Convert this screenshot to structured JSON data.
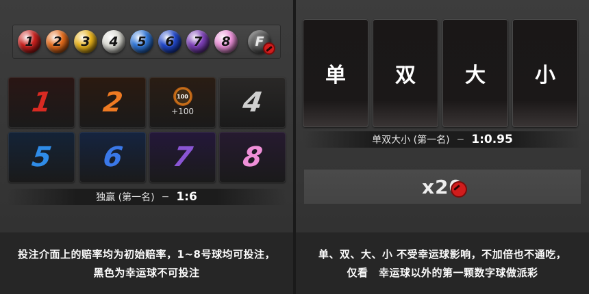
{
  "left": {
    "balls": [
      {
        "label": "1",
        "color": "#c8201d"
      },
      {
        "label": "2",
        "color": "#e36a1a"
      },
      {
        "label": "3",
        "color": "#e7b21b"
      },
      {
        "label": "4",
        "color": "#d9d9d2"
      },
      {
        "label": "5",
        "color": "#2d74d6"
      },
      {
        "label": "6",
        "color": "#1f46c9"
      },
      {
        "label": "7",
        "color": "#7c3fb6"
      },
      {
        "label": "8",
        "color": "#e98fd6"
      }
    ],
    "lucky_ball_label": "F",
    "cards": [
      {
        "label": "1",
        "text_color": "#d92a22",
        "bg": "#2a1614"
      },
      {
        "label": "2",
        "text_color": "#ef7a22",
        "bg": "#2b1a10"
      },
      {
        "label": "",
        "text_color": "#ffffff",
        "bg": "#2a1d14"
      },
      {
        "label": "4",
        "text_color": "#cfcfcf",
        "bg": "#2a2827"
      },
      {
        "label": "5",
        "text_color": "#2f8ce8",
        "bg": "#142337"
      },
      {
        "label": "6",
        "text_color": "#3a78e8",
        "bg": "#152440"
      },
      {
        "label": "7",
        "text_color": "#8a55d4",
        "bg": "#24183a"
      },
      {
        "label": "8",
        "text_color": "#ef8fd8",
        "bg": "#261a30"
      }
    ],
    "jackpot_chip": "100",
    "jackpot_bonus": "+100",
    "odds_label": "独赢 (第一名)",
    "odds_sep": "−",
    "odds_value": "1:6",
    "caption_line1": "投注介面上的赔率均为初始赔率，1~8号球均可投注，",
    "caption_line2": "黑色为幸运球不可投注"
  },
  "right": {
    "cards": [
      "单",
      "双",
      "大",
      "小"
    ],
    "odds_label": "单双大小 (第一名)",
    "odds_sep": "−",
    "odds_value": "1:0.95",
    "multiplier": "x20",
    "caption_line1": "单、双、大、小 不受幸运球影响，不加倍也不通吃，",
    "caption_line2": "仅看　幸运球以外的第一颗数字球做派彩"
  }
}
